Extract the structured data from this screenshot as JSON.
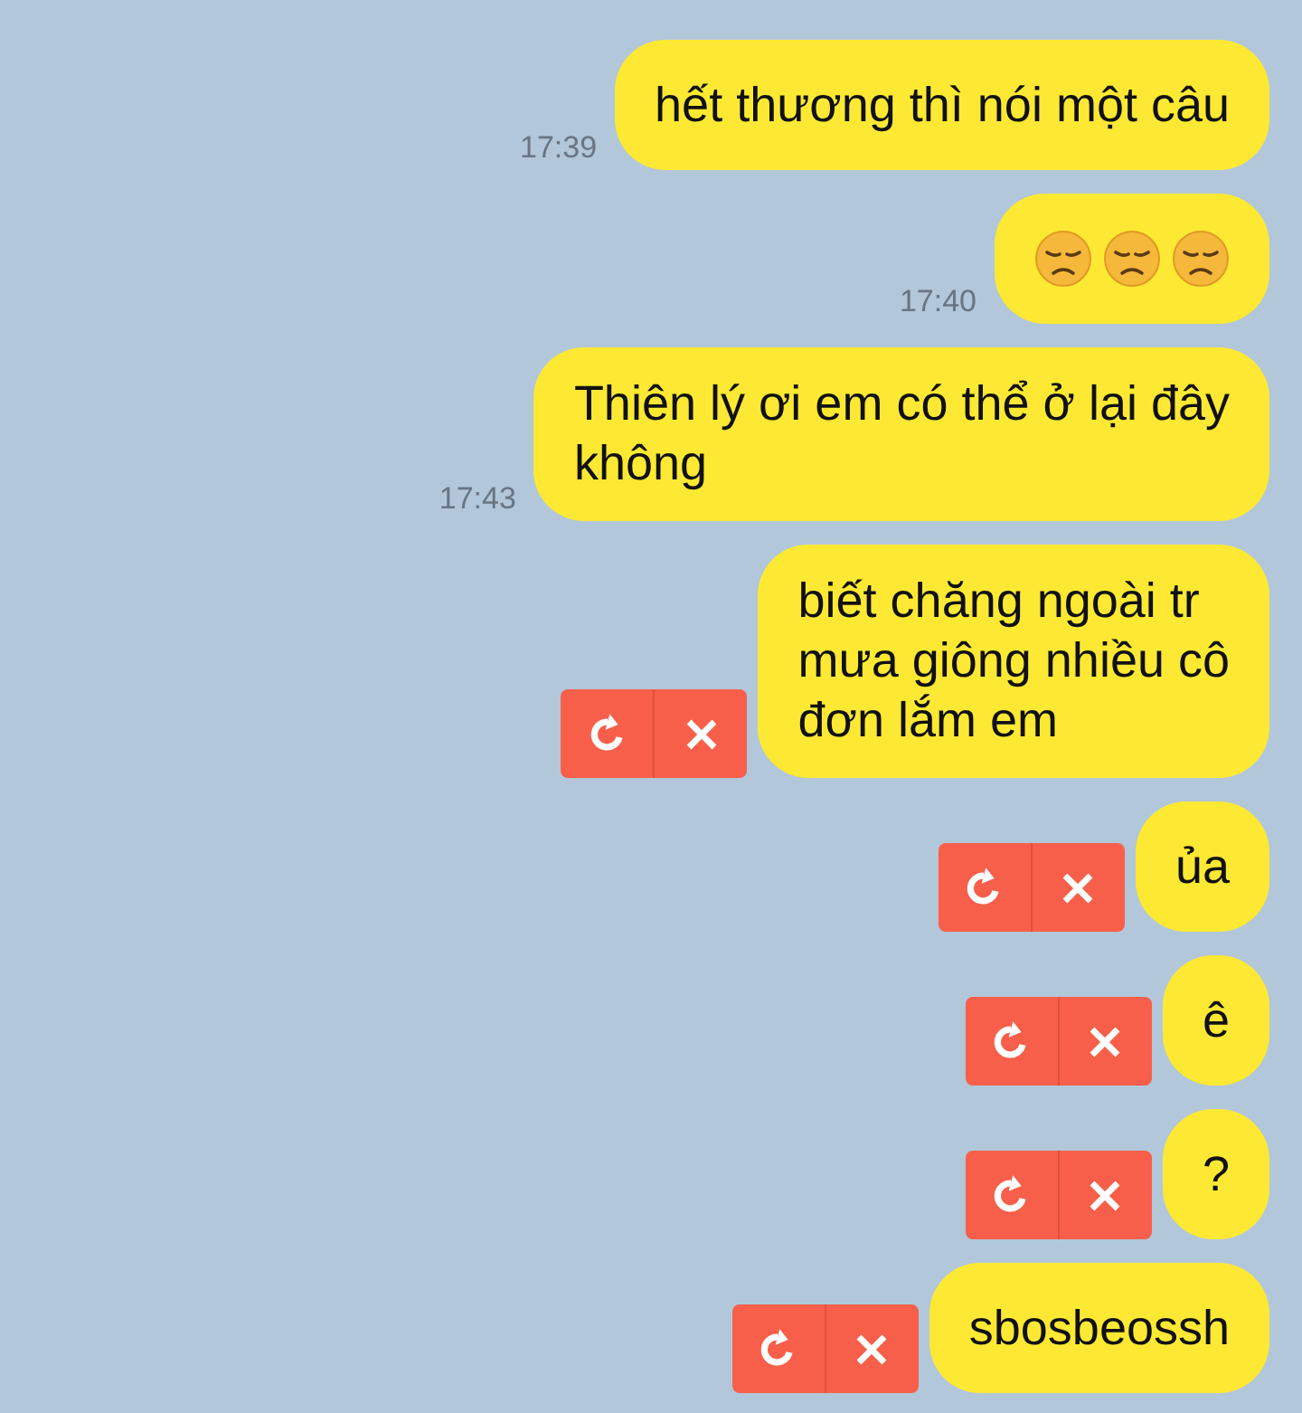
{
  "messages": [
    {
      "kind": "text",
      "lines": [
        "hết thương thì nói một câu"
      ],
      "time": "17:39",
      "failed": false
    },
    {
      "kind": "emoji",
      "time": "17:40",
      "failed": false
    },
    {
      "kind": "text",
      "lines": [
        "Thiên lý ơi em có thể ở lại đây",
        "không"
      ],
      "time": "17:43",
      "failed": false
    },
    {
      "kind": "text",
      "lines": [
        "biết chăng ngoài tr",
        "mưa giông nhiều cô",
        "đơn lắm em"
      ],
      "failed": true
    },
    {
      "kind": "text",
      "lines": [
        "ủa"
      ],
      "failed": true
    },
    {
      "kind": "text",
      "lines": [
        "ê"
      ],
      "failed": true
    },
    {
      "kind": "text",
      "lines": [
        "?"
      ],
      "failed": true
    },
    {
      "kind": "text",
      "lines": [
        "sbosbeossh"
      ],
      "failed": true
    }
  ]
}
